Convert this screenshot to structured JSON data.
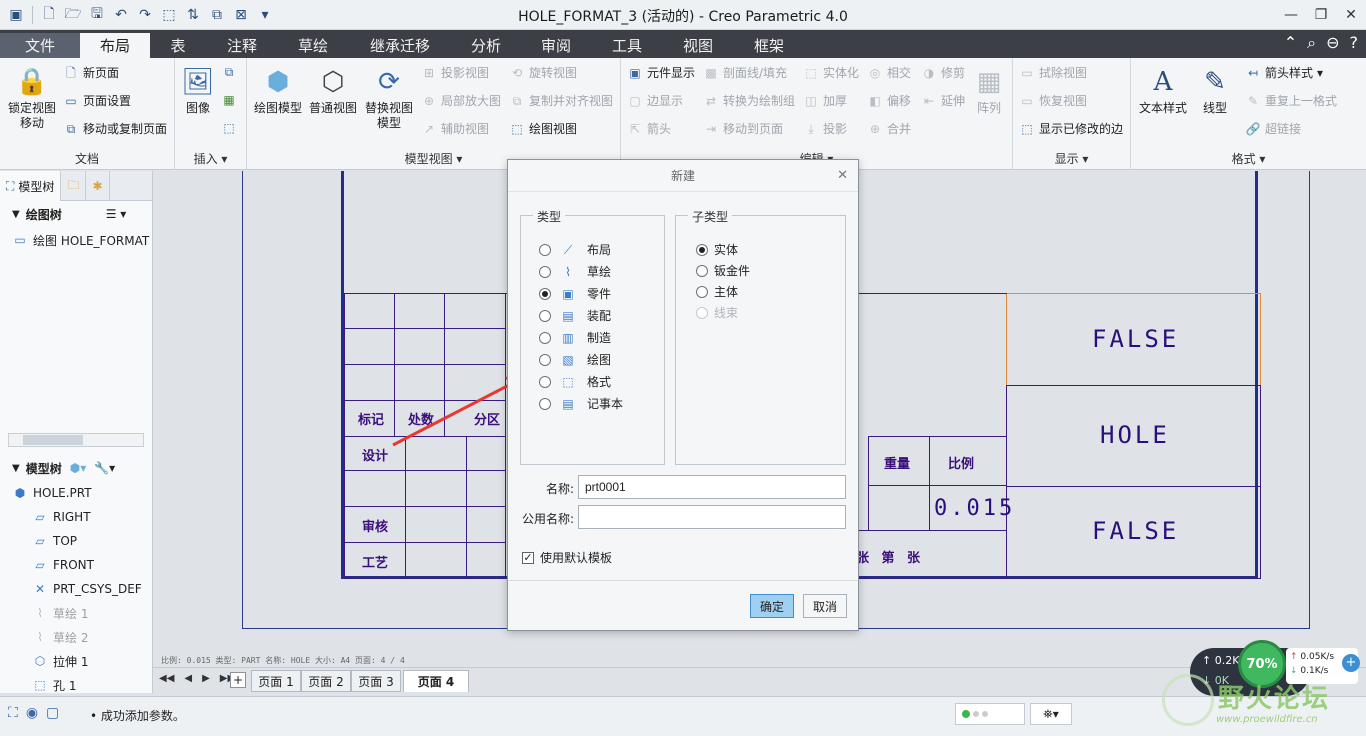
{
  "window": {
    "title": "HOLE_FORMAT_3 (活动的) - Creo Parametric 4.0"
  },
  "tabs": [
    "文件",
    "布局",
    "表",
    "注释",
    "草绘",
    "继承迁移",
    "分析",
    "审阅",
    "工具",
    "视图",
    "框架"
  ],
  "ribbon": {
    "doc_group": {
      "label": "文档",
      "lock_view": "锁定视图\n移动",
      "new_page": "新页面",
      "page_setup": "页面设置",
      "move_copy_page": "移动或复制页面"
    },
    "insert_group": {
      "label": "插入",
      "image": "图像"
    },
    "model_view_group": {
      "label": "模型视图",
      "drawing_model": "绘图模型",
      "general_view": "普通视图",
      "replace_view": "替换视图\n模型",
      "projection_view": "投影视图",
      "detail_view": "局部放大图",
      "auxiliary_view": "辅助视图",
      "revolve_view": "旋转视图",
      "copy_align_view": "复制并对齐视图",
      "drawing_view": "绘图视图"
    },
    "edit_group": {
      "label": "编辑",
      "element_display": "元件显示",
      "edge_display": "边显示",
      "arrow": "箭头",
      "section_hatch": "剖面线/填充",
      "convert_to_draw_group": "转换为绘制组",
      "move_to_page": "移动到页面",
      "solidify": "实体化",
      "thicken": "加厚",
      "project": "投影",
      "intersect": "相交",
      "offset": "偏移",
      "merge": "合并",
      "trim": "修剪",
      "extend": "延伸",
      "array": "阵列"
    },
    "display_group": {
      "label": "显示",
      "erase_view": "拭除视图",
      "restore_view": "恢复视图",
      "show_modified_edges": "显示已修改的边"
    },
    "format_group": {
      "label": "格式",
      "text_style": "文本样式",
      "line_style": "线型",
      "arrow_style": "箭头样式",
      "repeat_last_format": "重复上一格式",
      "hyperlink": "超链接"
    }
  },
  "left_panel": {
    "tabs": {
      "model_tree": "模型树"
    },
    "drawing_tree_title": "绘图树",
    "drawing_tree_item": "绘图 HOLE_FORMAT",
    "model_tree_title": "模型树",
    "model_tree_items": [
      {
        "label": "HOLE.PRT",
        "icon": "part-icon",
        "disabled": false
      },
      {
        "label": "RIGHT",
        "icon": "datum-plane-icon",
        "disabled": false
      },
      {
        "label": "TOP",
        "icon": "datum-plane-icon",
        "disabled": false
      },
      {
        "label": "FRONT",
        "icon": "datum-plane-icon",
        "disabled": false
      },
      {
        "label": "PRT_CSYS_DEF",
        "icon": "csys-icon",
        "disabled": false
      },
      {
        "label": "草绘 1",
        "icon": "sketch-icon",
        "disabled": true
      },
      {
        "label": "草绘 2",
        "icon": "sketch-icon",
        "disabled": true
      },
      {
        "label": "拉伸 1",
        "icon": "extrude-icon",
        "disabled": false
      },
      {
        "label": "孔 1",
        "icon": "hole-icon",
        "disabled": false
      }
    ]
  },
  "drawing": {
    "cells": {
      "false_top": "FALSE",
      "hole": "HOLE",
      "false_bottom": "FALSE",
      "scale_value": "0.015",
      "mark": "标记",
      "count": "处数",
      "zone": "分区",
      "design": "设计",
      "review": "审核",
      "process": "工艺",
      "weight": "重量",
      "ratio": "比例",
      "sheet_of": "张 第 张"
    },
    "info_line": "比例: 0.015   类型: PART   名称: HOLE   大小: A4   页面: 4 / 4"
  },
  "page_tabs": [
    "页面 1",
    "页面 2",
    "页面 3",
    "页面 4"
  ],
  "active_page": "页面 4",
  "status": {
    "message": "成功添加参数。"
  },
  "dialog": {
    "title": "新建",
    "type_legend": "类型",
    "subtype_legend": "子类型",
    "types": [
      {
        "label": "布局",
        "checked": false,
        "icon": "layout-icon"
      },
      {
        "label": "草绘",
        "checked": false,
        "icon": "sketch-icon"
      },
      {
        "label": "零件",
        "checked": true,
        "icon": "part-icon"
      },
      {
        "label": "装配",
        "checked": false,
        "icon": "assembly-icon"
      },
      {
        "label": "制造",
        "checked": false,
        "icon": "manufacturing-icon"
      },
      {
        "label": "绘图",
        "checked": false,
        "icon": "drawing-icon"
      },
      {
        "label": "格式",
        "checked": false,
        "icon": "format-icon"
      },
      {
        "label": "记事本",
        "checked": false,
        "icon": "notebook-icon"
      }
    ],
    "subtypes": [
      {
        "label": "实体",
        "checked": true,
        "disabled": false
      },
      {
        "label": "钣金件",
        "checked": false,
        "disabled": false
      },
      {
        "label": "主体",
        "checked": false,
        "disabled": false
      },
      {
        "label": "线束",
        "checked": false,
        "disabled": true
      }
    ],
    "name_label": "名称:",
    "name_value": "prt0001",
    "common_name_label": "公用名称:",
    "common_name_value": "",
    "use_default_template": "使用默认模板",
    "ok": "确定",
    "cancel": "取消"
  },
  "network_widget": {
    "up": "0.2K",
    "down": "0K",
    "percent": "70%",
    "up_rate": "0.05K/s",
    "down_rate": "0.1K/s"
  },
  "watermark": {
    "text": "野火论坛",
    "url": "www.proewildfire.cn"
  },
  "colors": {
    "accent": "#3c8fd0",
    "tab_bar": "#3c3f45",
    "frame": "#1f2f8a",
    "selection": "#e08a3c"
  }
}
